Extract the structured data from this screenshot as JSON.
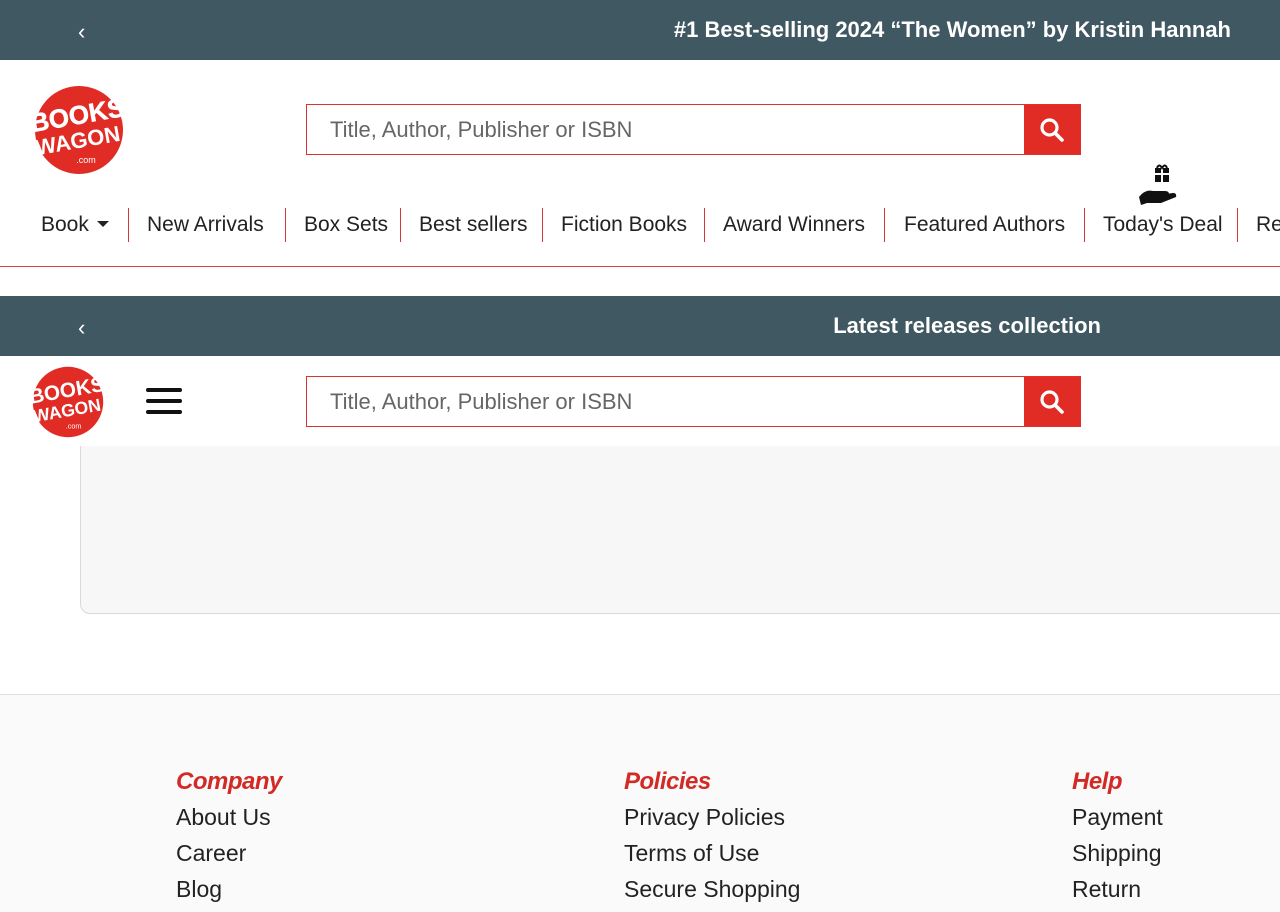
{
  "promo_bar_top": {
    "prev_icon": "chevron-left-icon",
    "text": "#1 Best-selling 2024 “The Women” by Kristin Hannah"
  },
  "header": {
    "logo": {
      "line1": "BOOKS",
      "line2": "WAGON",
      "line3": ".com"
    },
    "search": {
      "placeholder": "Title, Author, Publisher or ISBN",
      "value": ""
    }
  },
  "nav": {
    "items": [
      "Book",
      "New Arrivals",
      "Box Sets",
      "Best sellers",
      "Fiction Books",
      "Award Winners",
      "Featured Authors",
      "Today's Deal",
      "Re"
    ]
  },
  "promo_bar_sticky": {
    "prev_icon": "chevron-left-icon",
    "text": "Latest releases collection"
  },
  "sticky_header": {
    "search": {
      "placeholder": "Title, Author, Publisher or ISBN",
      "value": ""
    }
  },
  "footer": {
    "columns": [
      {
        "title": "Company",
        "links": [
          "About Us",
          "Career",
          "Blog"
        ]
      },
      {
        "title": "Policies",
        "links": [
          "Privacy Policies",
          "Terms of Use",
          "Secure Shopping"
        ]
      },
      {
        "title": "Help",
        "links": [
          "Payment",
          "Shipping",
          "Return"
        ]
      }
    ]
  },
  "colors": {
    "promo_bg": "#405861",
    "brand_red": "#e12c26",
    "accent_red": "#d22a24"
  }
}
